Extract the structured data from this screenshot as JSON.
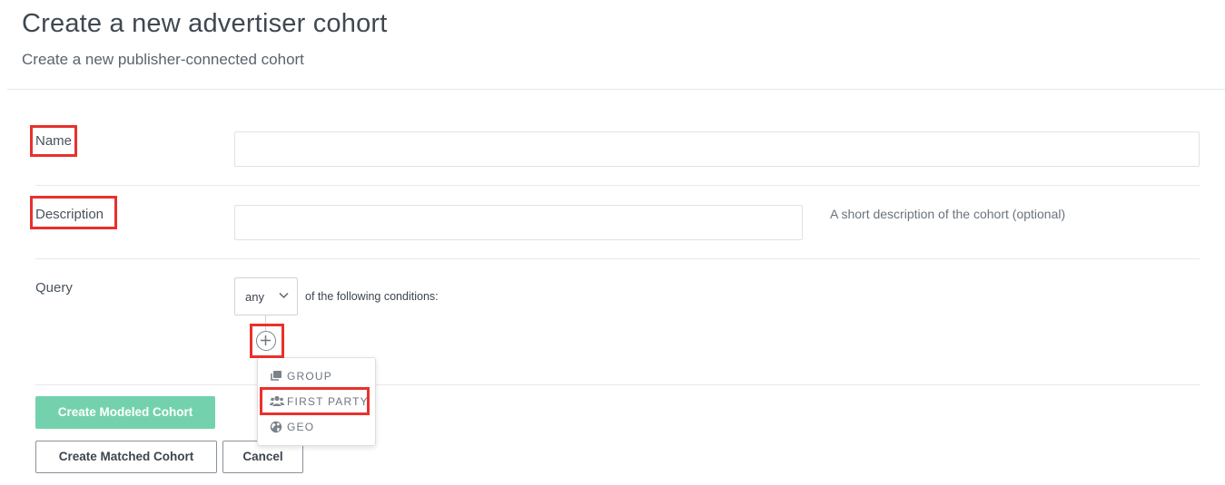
{
  "header": {
    "title": "Create a new advertiser cohort",
    "subtitle": "Create a new publisher-connected cohort"
  },
  "form": {
    "name": {
      "label": "Name",
      "value": "",
      "placeholder": ""
    },
    "description": {
      "label": "Description",
      "value": "",
      "placeholder": "",
      "hint": "A short description of the cohort (optional)"
    },
    "query": {
      "label": "Query",
      "match_select": {
        "value": "any"
      },
      "conditions_text": "of the following conditions:"
    }
  },
  "add_condition_menu": {
    "items": [
      {
        "label": "GROUP",
        "icon": "group-icon"
      },
      {
        "label": "FIRST PARTY",
        "icon": "users-icon"
      },
      {
        "label": "GEO",
        "icon": "globe-icon"
      }
    ]
  },
  "actions": {
    "create_modeled": "Create Modeled Cohort",
    "create_matched": "Create Matched Cohort",
    "cancel": "Cancel"
  },
  "colors": {
    "primary_button": "#73d2ad",
    "highlight_border": "#e8312d"
  }
}
